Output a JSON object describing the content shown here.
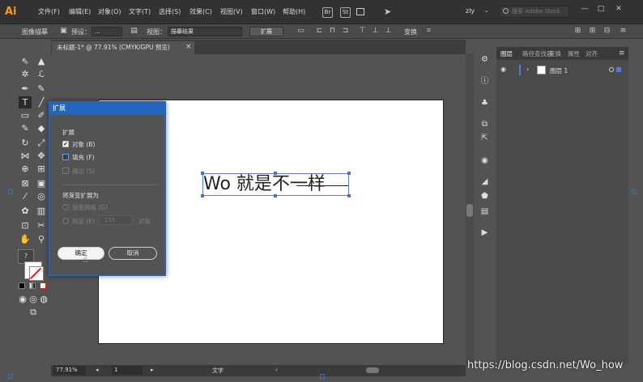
{
  "app": {
    "logo": "Ai"
  },
  "menu": [
    "文件(F)",
    "编辑(E)",
    "对象(O)",
    "文字(T)",
    "选择(S)",
    "效果(C)",
    "视图(V)",
    "窗口(W)",
    "帮助(H)"
  ],
  "menubar_icons": {
    "bridge": "Br",
    "stock": "St"
  },
  "workspace": "zly",
  "search": {
    "placeholder": "搜索 Adobe Stock"
  },
  "window_buttons": {
    "minimize": "—",
    "restore": "□",
    "close": "✕"
  },
  "control_bar": {
    "label": "图像描摹",
    "preset_label": "预设：",
    "preset_value": "...",
    "view_label": "视图：",
    "view_value": "描摹结果",
    "expand_button": "扩展",
    "transform_button": "变换"
  },
  "document_tab": {
    "title": "未标题-1* @ 77.91% (CMYK/GPU 预览)",
    "close": "×"
  },
  "artboard_text": {
    "main": "Wo 就是不",
    "struck": "一样"
  },
  "status_bar": {
    "zoom": "77.91%",
    "page": "1",
    "tool": "文字"
  },
  "layers_panel": {
    "tabs": [
      "图层",
      "路径查找器",
      "变换",
      "属性",
      "对齐"
    ],
    "layer_name": "图层 1"
  },
  "dialog": {
    "title": "扩展",
    "group_expand": "扩展",
    "object_label": "对象 (B)",
    "fill_label": "填充 (F)",
    "stroke_label": "描边 (S)",
    "group_gradient": "将渐变扩展为",
    "gradient_mesh_label": "渐变网格 (G)",
    "specify_label": "指定 (E)",
    "specify_value": "255",
    "specify_unit": "对象",
    "ok_button": "确定",
    "cancel_button": "取消"
  },
  "watermark": "https://blog.csdn.net/Wo_how"
}
